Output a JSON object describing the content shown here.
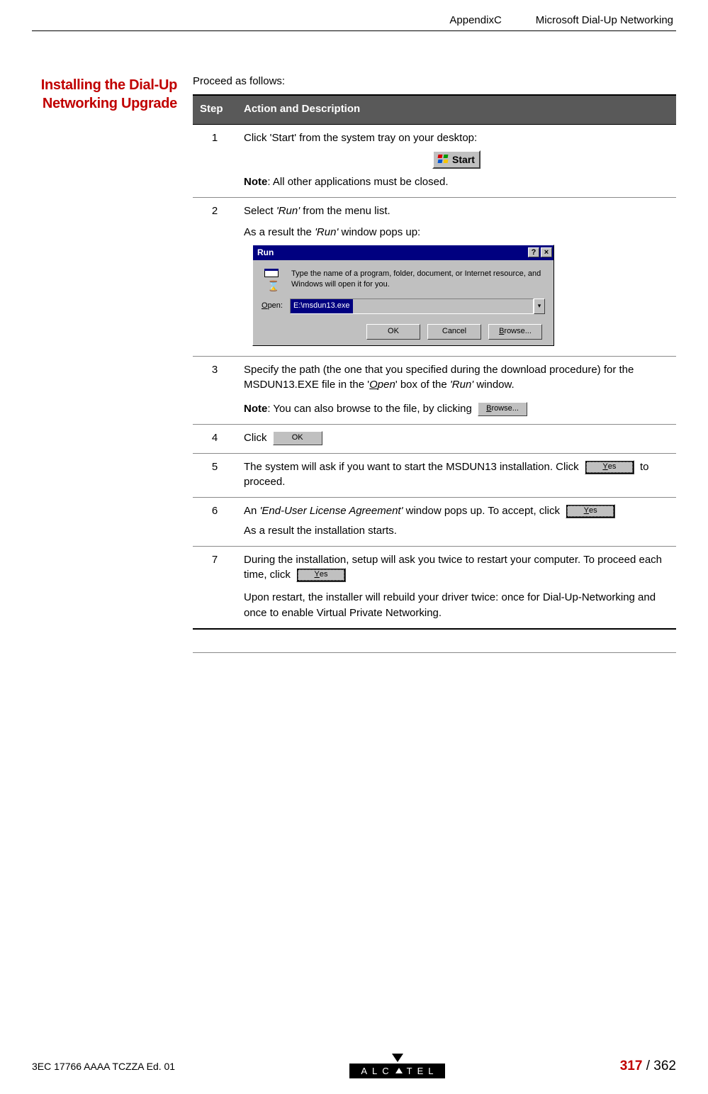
{
  "header": {
    "appendix": "AppendixC",
    "title": "Microsoft Dial-Up Networking"
  },
  "side_heading": "Installing the Dial-Up Networking Upgrade",
  "intro": "Proceed as follows:",
  "table": {
    "head_step": "Step",
    "head_action": "Action and Description"
  },
  "steps": {
    "s1": {
      "num": "1",
      "line1": "Click 'Start' from the system tray on your desktop:",
      "note_label": "Note",
      "note_text": ": All other applications must be closed.",
      "start_btn": "Start"
    },
    "s2": {
      "num": "2",
      "line1a": "Select ",
      "run_italic": "'Run'",
      "line1b": " from the menu list.",
      "line2a": "As a result the ",
      "line2b": " window pops up:"
    },
    "s3": {
      "num": "3",
      "text_a": "Specify the path (the one that you specified during the download procedure) for the MSDUN13.EXE file in the '",
      "open_u": "O",
      "open_rest": "pen",
      "text_b": "' box of the ",
      "run_italic": "'Run'",
      "text_c": " window.",
      "note_label": "Note",
      "note_text": ": You can also browse to the file, by clicking",
      "browse_u": "B",
      "browse_rest": "rowse..."
    },
    "s4": {
      "num": "4",
      "text": "Click",
      "ok": "OK"
    },
    "s5": {
      "num": "5",
      "text_a": "The system will ask if you want to start the MSDUN13 installation. Click",
      "text_b": " to proceed.",
      "yes_u": "Y",
      "yes_rest": "es"
    },
    "s6": {
      "num": "6",
      "text_a": "An ",
      "eula_italic": "'End-User License Agreement'",
      "text_b": " window pops up. To accept, click",
      "text_c": "As a result the installation starts.",
      "yes_u": "Y",
      "yes_rest": "es"
    },
    "s7": {
      "num": "7",
      "text_a": "During the installation, setup will ask you twice to restart your computer. To proceed each time, click",
      "text_b": "Upon restart, the installer will rebuild your driver twice: once for Dial-Up-Networking and once to enable Virtual Private Networking.",
      "yes_u": "Y",
      "yes_rest": "es"
    }
  },
  "run_dialog": {
    "title": "Run",
    "help": "?",
    "close": "×",
    "prompt": "Type the name of a program, folder, document, or Internet resource, and Windows will open it for you.",
    "open_u": "O",
    "open_rest": "pen:",
    "value": "E:\\msdun13.exe",
    "ok": "OK",
    "cancel": "Cancel",
    "browse_u": "B",
    "browse_rest": "rowse..."
  },
  "footer": {
    "doc_id": "3EC 17766 AAAA TCZZA Ed. 01",
    "logo_left": "ALC",
    "logo_right": "TEL",
    "page_current": "317",
    "page_sep": " / ",
    "page_total": "362"
  }
}
